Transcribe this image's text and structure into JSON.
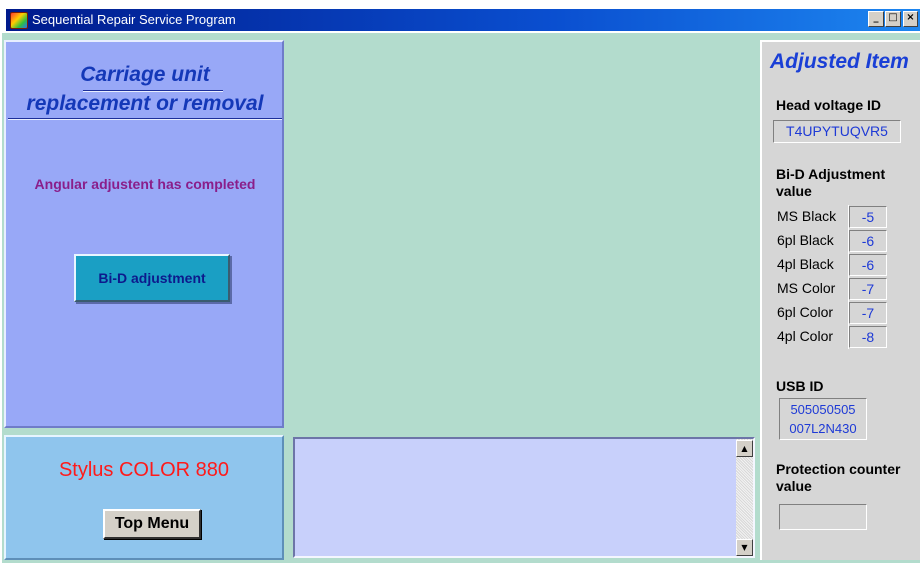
{
  "window": {
    "title": "Sequential Repair Service Program",
    "minimize_glyph": "_",
    "restore_glyph": "□",
    "close_glyph": "×"
  },
  "left_panel": {
    "heading_line1": "Carriage unit",
    "heading_line2": "replacement or removal",
    "status_message": "Angular adjustent has completed",
    "bid_button_label": "Bi-D adjustment"
  },
  "model_panel": {
    "model_name": "Stylus COLOR 880",
    "top_menu_label": "Top Menu"
  },
  "message_area": {
    "text": "",
    "scroll_up_glyph": "▲",
    "scroll_down_glyph": "▼"
  },
  "adjusted_panel": {
    "title": "Adjusted Item",
    "head_voltage_label": "Head voltage ID",
    "head_voltage_value": "T4UPYTUQVR5",
    "bid_label": "Bi-D Adjustment value",
    "bid_rows": [
      {
        "label": "MS Black",
        "value": "-5"
      },
      {
        "label": "6pl Black",
        "value": "-6"
      },
      {
        "label": "4pl Black",
        "value": "-6"
      },
      {
        "label": "MS Color",
        "value": "-7"
      },
      {
        "label": "6pl Color",
        "value": "-7"
      },
      {
        "label": "4pl Color",
        "value": "-8"
      }
    ],
    "usb_label": "USB ID",
    "usb_line1": "505050505",
    "usb_line2": "007L2N430",
    "protection_label": "Protection counter value",
    "protection_value": ""
  },
  "colors": {
    "client_bg": "#b3dccd",
    "left_panel_bg": "#98a8f7",
    "model_panel_bg": "#8fc5ed",
    "heading_blue": "#1438b8",
    "status_purple": "#8a1e8a",
    "model_red": "#ff1a1a",
    "button_cyan": "#1a9fc4",
    "value_blue": "#1e3ad6"
  },
  "icons": {
    "app": "app-icon",
    "minimize": "minimize-icon",
    "restore": "restore-icon",
    "close": "close-icon"
  }
}
